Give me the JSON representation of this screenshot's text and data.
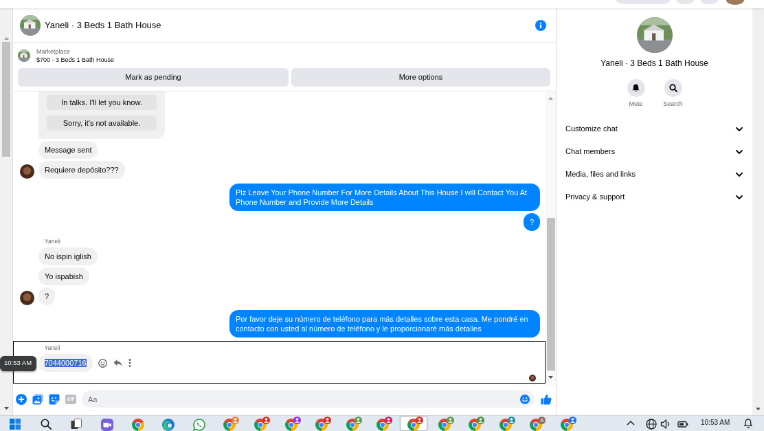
{
  "conversation": {
    "title": "Yaneli · 3 Beds 1 Bath House"
  },
  "listing": {
    "source": "Marketplace",
    "title": "$700 - 3 Beds 1 Bath House",
    "buttons": [
      "Mark as pending",
      "More options"
    ]
  },
  "messages": [
    {
      "kind": "incoming",
      "focused": false,
      "seen": false,
      "items": [
        {
          "kind": "quick_replies",
          "options": [
            "In talks. I'll let you know.",
            "Sorry, it's not available."
          ]
        },
        {
          "kind": "text",
          "text": "Message sent",
          "text_selected": false
        },
        {
          "kind": "text",
          "text": "Requiere depósito???",
          "text_selected": false
        }
      ]
    },
    {
      "kind": "outgoing",
      "focused": false,
      "seen": false,
      "items": [
        {
          "kind": "text",
          "text": "Plz Leave Your Phone Number For More Details About This House I will Contact You At Phone Number and Provide More Details",
          "text_selected": false
        },
        {
          "kind": "text",
          "text": "?",
          "text_selected": false
        }
      ]
    },
    {
      "kind": "incoming",
      "sender": "Yaneli",
      "focused": false,
      "seen": false,
      "items": [
        {
          "kind": "text",
          "text": "No ispin iglish",
          "text_selected": false
        },
        {
          "kind": "text",
          "text": "Yo ispabish",
          "text_selected": false
        },
        {
          "kind": "text",
          "text": "?",
          "text_selected": false
        }
      ]
    },
    {
      "kind": "outgoing",
      "focused": false,
      "seen": false,
      "items": [
        {
          "kind": "text",
          "text": "Por favor deje su número de teléfono para más detalles sobre esta casa. Me pondré en contacto con usted al número de teléfono y le proporcionaré más detalles",
          "text_selected": false
        }
      ]
    },
    {
      "kind": "incoming",
      "sender": "Yaneli",
      "focused": true,
      "seen": true,
      "tooltip": "10:53 AM",
      "items": [
        {
          "kind": "text",
          "text": "7044000716",
          "text_selected": true
        }
      ]
    }
  ],
  "composer": {
    "gif_label": "GIF",
    "gif_disabled": true,
    "placeholder": "Aa"
  },
  "details": {
    "title": "Yaneli · 3 Beds 1 Bath House",
    "actions": [
      {
        "kind": "mute",
        "label": "Mute"
      },
      {
        "kind": "search",
        "label": "Search"
      }
    ],
    "sections": [
      {
        "label": "Customize chat",
        "expanded": false
      },
      {
        "label": "Chat members",
        "expanded": false
      },
      {
        "label": "Media, files and links",
        "expanded": false
      },
      {
        "label": "Privacy & support",
        "expanded": false
      }
    ]
  },
  "taskbar": {
    "apps": [
      {
        "kind": "start",
        "selected": false
      },
      {
        "kind": "search",
        "selected": false
      },
      {
        "kind": "task_view",
        "selected": false
      },
      {
        "kind": "video_chat",
        "selected": false
      },
      {
        "kind": "browser",
        "selected": false
      },
      {
        "kind": "edge",
        "selected": false
      },
      {
        "kind": "messaging",
        "selected": false
      },
      {
        "kind": "browser_profile",
        "color": "#e8833a",
        "selected": false
      },
      {
        "kind": "browser_profile",
        "color": "#d93025",
        "selected": false
      },
      {
        "kind": "browser_profile",
        "color": "#9334e6",
        "selected": false
      },
      {
        "kind": "browser_profile",
        "color": "#d93025",
        "selected": false
      },
      {
        "kind": "browser_profile",
        "color": "#5e9c4b",
        "selected": false
      },
      {
        "kind": "browser_profile",
        "color": "#d81b60",
        "selected": false
      },
      {
        "kind": "browser_profile",
        "color": "#d93025",
        "selected": true
      },
      {
        "kind": "browser_profile",
        "color": "#5e9c4b",
        "selected": false
      },
      {
        "kind": "browser_profile",
        "color": "#4f8f3f",
        "selected": false
      },
      {
        "kind": "browser_profile",
        "color": "#2a8c9e",
        "selected": false
      },
      {
        "kind": "browser_profile",
        "color": "#8d6e63",
        "badge_text": "A",
        "selected": false
      },
      {
        "kind": "browser_profile",
        "color": "#1a73e8",
        "selected": false
      }
    ],
    "clock": "10:53 AM"
  }
}
